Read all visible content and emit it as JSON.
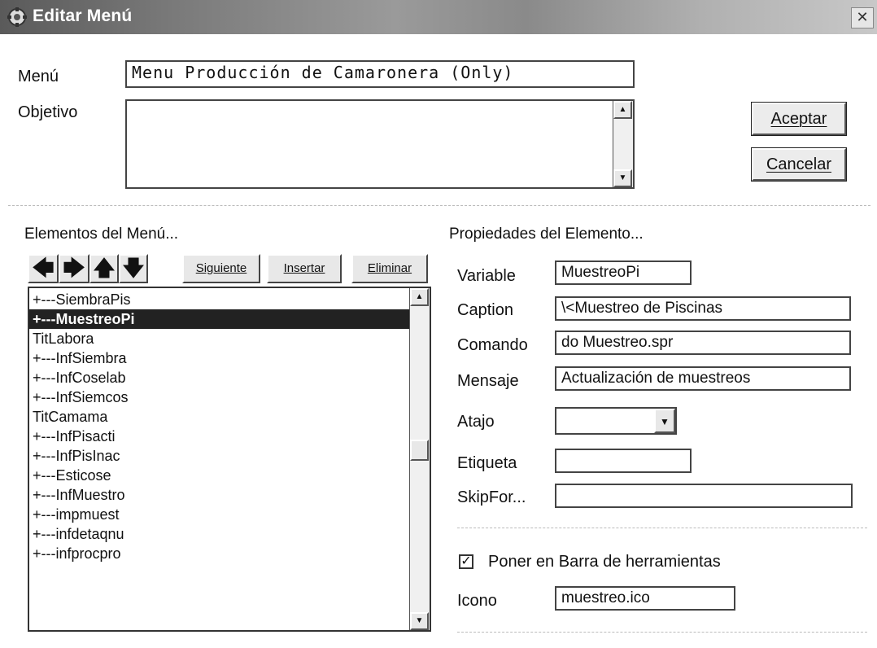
{
  "window": {
    "title": "Editar Menú",
    "close_glyph": "✕",
    "icon": "app-gear-icon"
  },
  "form": {
    "menu_label": "Menú",
    "menu_value": "Menu Producción de Camaronera (Only)",
    "objetivo_label": "Objetivo",
    "objetivo_value": ""
  },
  "buttons": {
    "accept_label": "Aceptar",
    "cancel_label": "Cancelar"
  },
  "elements": {
    "section_title": "Elementos del Menú...",
    "toolbar": {
      "left_glyph": "🡄",
      "right_glyph": "🡆",
      "up_glyph": "🡅",
      "down_glyph": "🡇",
      "next_label": "Siguiente",
      "insert_label": "Insertar",
      "delete_label": "Eliminar"
    },
    "items": [
      "+---SiembraPis",
      "+---MuestreoPi",
      "TitLabora",
      "+---InfSiembra",
      "+---InfCoselab",
      "+---InfSiemcos",
      "TitCamama",
      "+---InfPisacti",
      "+---InfPisInac",
      "+---Esticose",
      "+---InfMuestro",
      "+---impmuest",
      "+---infdetaqnu",
      "+---infprocpro"
    ],
    "selected_index": 1
  },
  "properties": {
    "section_title": "Propiedades del Elemento...",
    "variable_label": "Variable",
    "variable_value": "MuestreoPi",
    "caption_label": "Caption",
    "caption_value": "\\<Muestreo de Piscinas",
    "comando_label": "Comando",
    "comando_value": "do Muestreo.spr",
    "mensaje_label": "Mensaje",
    "mensaje_value": "Actualización de muestreos",
    "atajo_label": "Atajo",
    "atajo_value": "",
    "etiqueta_label": "Etiqueta",
    "etiqueta_value": "",
    "skipfor_label": "SkipFor...",
    "skipfor_value": "",
    "toolbar_check_label": "Poner en Barra de herramientas",
    "toolbar_checked": true,
    "icono_label": "Icono",
    "icono_value": "muestreo.ico"
  }
}
